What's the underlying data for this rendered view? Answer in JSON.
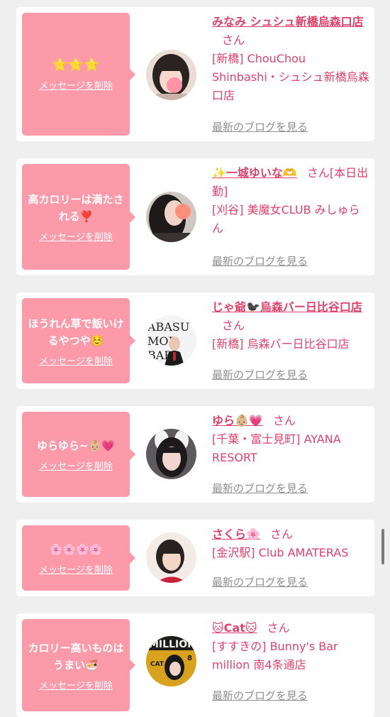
{
  "common": {
    "delete_label": "メッセージを削除",
    "blog_label": "最新のブログを見る",
    "san": "さん"
  },
  "colors": {
    "bubble": "#fd9aa9",
    "accent": "#e0416b",
    "link_gray": "#8f8f8f",
    "background": "#efefef"
  },
  "entries": [
    {
      "message": "⭐⭐⭐",
      "name": "みなみ シュシュ新橋烏森口店",
      "name_suffix": "さん",
      "store": "[新橋] ChouChou Shinbashi・シュシュ新橋烏森口店",
      "avatar_icon": "woman-portrait-icon"
    },
    {
      "message": "高カロリーは満たされる❣️",
      "name": "✨一城ゆいな🫶",
      "name_suffix": "さん[本日出勤]",
      "store": "[刈谷] 美魔女CLUB みしゅらん",
      "avatar_icon": "woman-portrait-icon"
    },
    {
      "message": "ほうれん草で飯いけるやつや☺️",
      "name": "じゃ爺🐦‍⬛烏森バー日比谷口店",
      "name_suffix": "さん",
      "store": "[新橋] 烏森バー日比谷口店",
      "avatar_icon": "man-portrait-icon"
    },
    {
      "message": "ゆらゆら~👶🏼💗",
      "name": "ゆら👶🏼💗",
      "name_suffix": "さん",
      "store": "[千葉・富士見町] AYANA RESORT",
      "avatar_icon": "woman-portrait-icon"
    },
    {
      "message": "🌸🌸🌸🌸",
      "name": "さくら🌸",
      "name_suffix": "さん",
      "store": "[金沢駅] Club AMATERAS",
      "avatar_icon": "woman-portrait-icon"
    },
    {
      "message": "カロリー高いものはうまい🍜",
      "name": "🐱Cat🐱",
      "name_suffix": "さん",
      "store": "[すすきの] Bunny's Bar million 南4条通店",
      "avatar_icon": "woman-portrait-icon"
    }
  ]
}
